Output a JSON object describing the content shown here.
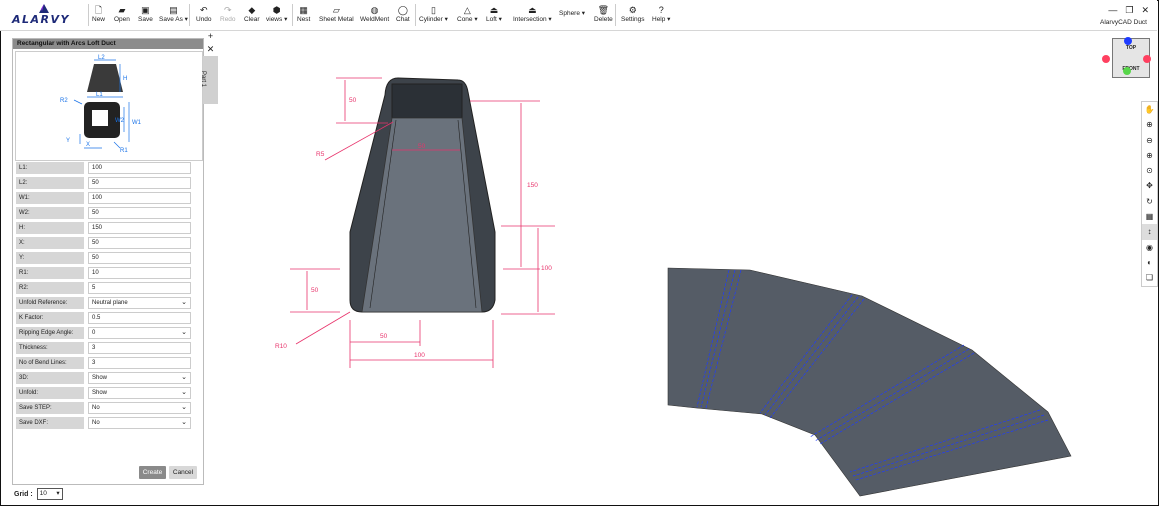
{
  "brand": {
    "logo_text": "ALARVY",
    "app_title": "AlarvyCAD Duct"
  },
  "toolbar": {
    "new": "New",
    "open": "Open",
    "save": "Save",
    "save_as": "Save As",
    "undo": "Undo",
    "redo": "Redo",
    "clear": "Clear",
    "views": "views",
    "nest": "Nest",
    "sheet_metal": "Sheet Metal",
    "weldment": "WeldMent",
    "chat": "Chat",
    "cylinder": "Cylinder",
    "cone": "Cone",
    "loft": "Loft",
    "intersection": "Intersection",
    "sphere": "Sphere",
    "delete": "Delete",
    "settings": "Settings",
    "help": "Help"
  },
  "panel": {
    "title": "Rectangular with Arcs Loft Duct",
    "diagram_labels": {
      "l2": "L2",
      "h": "H",
      "l1": "L1",
      "r2": "R2",
      "w2": "W2",
      "w1": "W1",
      "y": "Y",
      "x": "X",
      "r1": "R1"
    },
    "fields": [
      {
        "label": "L1:",
        "value": "100"
      },
      {
        "label": "L2:",
        "value": "50"
      },
      {
        "label": "W1:",
        "value": "100"
      },
      {
        "label": "W2:",
        "value": "50"
      },
      {
        "label": "H:",
        "value": "150"
      },
      {
        "label": "X:",
        "value": "50"
      },
      {
        "label": "Y:",
        "value": "50"
      },
      {
        "label": "R1:",
        "value": "10"
      },
      {
        "label": "R2:",
        "value": "5"
      },
      {
        "label": "Unfold Reference:",
        "value": "Neutral plane"
      },
      {
        "label": "K Factor:",
        "value": "0.5"
      },
      {
        "label": "Ripping Edge Angle:",
        "value": "0"
      },
      {
        "label": "Thickness:",
        "value": "3"
      },
      {
        "label": "No of Bend Lines:",
        "value": "3"
      },
      {
        "label": "3D:",
        "value": "Show"
      },
      {
        "label": "Unfold:",
        "value": "Show"
      },
      {
        "label": "Save STEP:",
        "value": "No"
      },
      {
        "label": "Save DXF:",
        "value": "No"
      }
    ],
    "create": "Create",
    "cancel": "Cancel"
  },
  "grid": {
    "label": "Grid :",
    "value": "10"
  },
  "tabs": {
    "part": "Part 1"
  },
  "viewcube": {
    "top": "TOP",
    "front": "FRONT"
  },
  "dimensions": {
    "d50_top": "50",
    "r5": "R5",
    "d50_inner": "50",
    "d150": "150",
    "d100_right": "100",
    "d50_bottom": "50",
    "r10": "R10",
    "d50_base": "50",
    "d100_base": "100"
  },
  "colors": {
    "accent_red": "#e8336b",
    "bend_line": "#1e3cff",
    "model_gray": "#555c66"
  }
}
